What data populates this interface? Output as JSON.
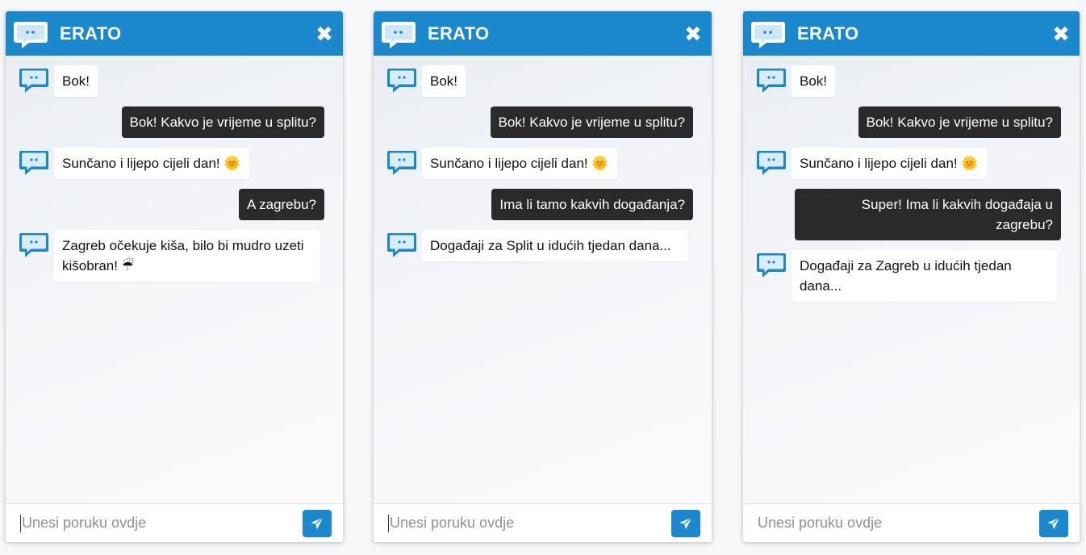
{
  "brand_color": "#1b87cc",
  "user_bubble_color": "#2a2a2a",
  "widgets": [
    {
      "title": "ERATO",
      "close_glyph": "✖",
      "input_placeholder": "Unesi poruku ovdje",
      "send_icon": "paper-plane-icon",
      "messages": [
        {
          "from": "bot",
          "text": "Bok!"
        },
        {
          "from": "user",
          "text": "Bok! Kakvo je vrijeme u splitu?"
        },
        {
          "from": "bot",
          "text": "Sunčano i lijepo cijeli dan!",
          "emoji": "🌞"
        },
        {
          "from": "user",
          "text": "A zagrebu?"
        },
        {
          "from": "bot",
          "text": "Zagreb očekuje kiša, bilo bi mudro uzeti kišobran!",
          "emoji": "☔"
        }
      ]
    },
    {
      "title": "ERATO",
      "close_glyph": "✖",
      "input_placeholder": "Unesi poruku ovdje",
      "send_icon": "paper-plane-icon",
      "messages": [
        {
          "from": "bot",
          "text": "Bok!"
        },
        {
          "from": "user",
          "text": "Bok! Kakvo je vrijeme u splitu?"
        },
        {
          "from": "bot",
          "text": "Sunčano i lijepo cijeli dan!",
          "emoji": "🌞"
        },
        {
          "from": "user",
          "text": "Ima li tamo kakvih događanja?"
        },
        {
          "from": "bot",
          "text": "Događaji za Split u idućih tjedan dana..."
        }
      ]
    },
    {
      "title": "ERATO",
      "close_glyph": "✖",
      "input_placeholder": "Unesi poruku ovdje",
      "send_icon": "paper-plane-icon",
      "messages": [
        {
          "from": "bot",
          "text": "Bok!"
        },
        {
          "from": "user",
          "text": "Bok! Kakvo je vrijeme u splitu?"
        },
        {
          "from": "bot",
          "text": "Sunčano i lijepo cijeli dan!",
          "emoji": "🌞"
        },
        {
          "from": "user",
          "text": "Super! Ima li kakvih događaja u zagrebu?"
        },
        {
          "from": "bot",
          "text": "Događaji za Zagreb u idućih tjedan dana..."
        }
      ]
    }
  ]
}
